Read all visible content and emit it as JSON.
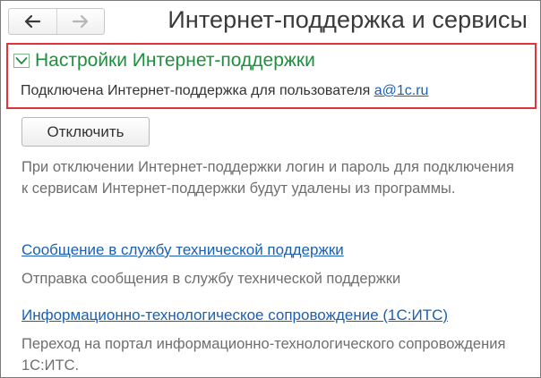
{
  "header": {
    "title": "Интернет-поддержка и сервисы",
    "back_icon": "arrow-left",
    "forward_icon": "arrow-right"
  },
  "group": {
    "title": "Настройки Интернет-поддержки",
    "connected_text": "Подключена Интернет-поддержка для пользователя ",
    "user_login": "a@1c.ru",
    "expanded": true
  },
  "disconnect": {
    "button_label": "Отключить",
    "note": "При отключении Интернет-поддержки логин и пароль для подключения к сервисам Интернет-поддержки будут удалены из программы."
  },
  "support": {
    "link": "Сообщение в службу технической поддержки",
    "note": "Отправка сообщения в службу технической поддержки"
  },
  "its": {
    "link": "Информационно-технологическое сопровождение (1С:ИТС)",
    "note": "Переход на портал информационно-технологического сопровождения 1С:ИТС."
  },
  "colors": {
    "group_title": "#1f8f3f",
    "highlight_border": "#e0333a",
    "link": "#1a5fb4",
    "note_text": "#6e6e6e"
  }
}
